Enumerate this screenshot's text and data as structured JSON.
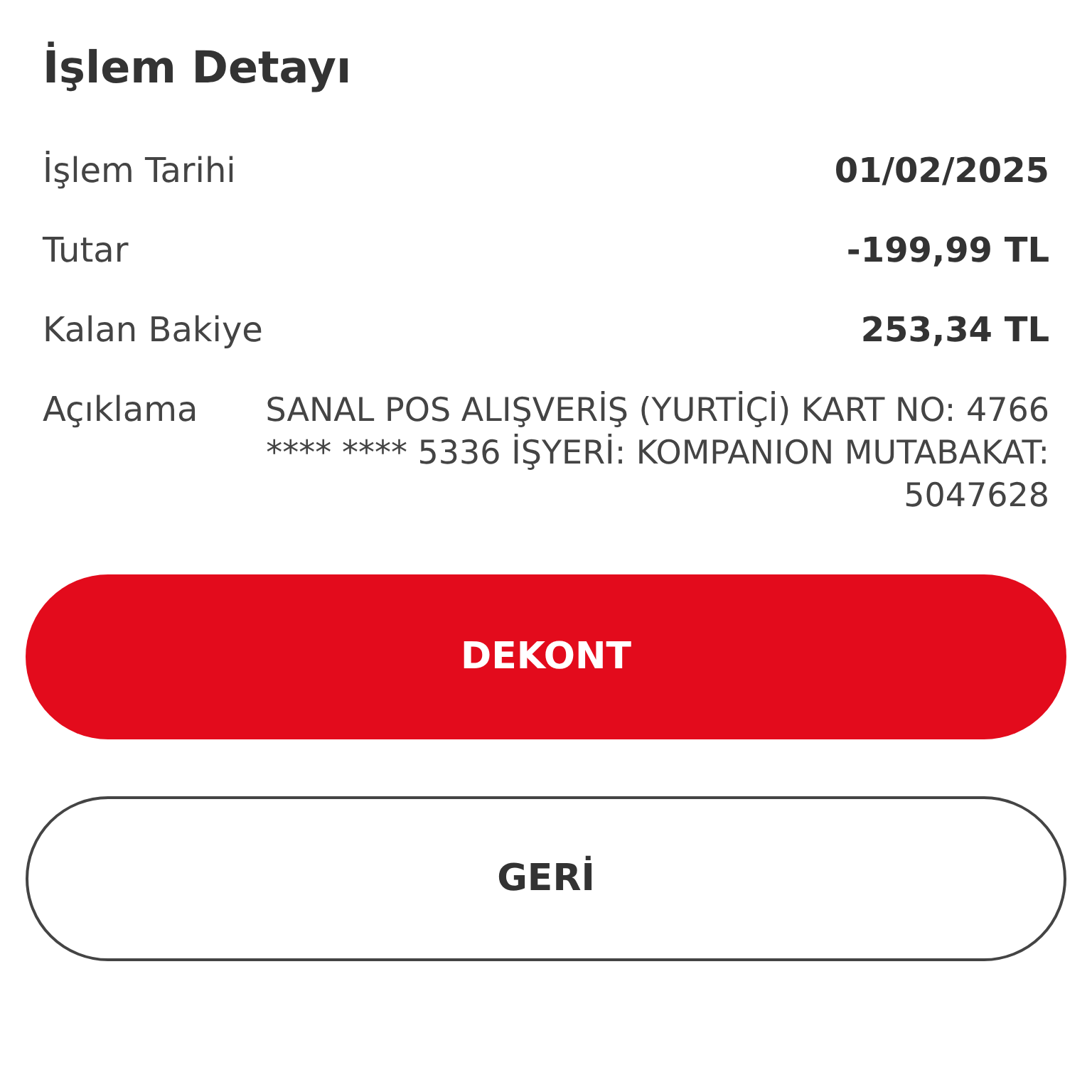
{
  "title": "İşlem Detayı",
  "rows": [
    {
      "label": "İşlem Tarihi",
      "value": "01/02/2025",
      "kind": "bold"
    },
    {
      "label": "Tutar",
      "value": "-199,99 TL",
      "kind": "bold"
    },
    {
      "label": "Kalan Bakiye",
      "value": "253,34 TL",
      "kind": "bold"
    },
    {
      "label": "Açıklama",
      "value": "SANAL POS ALIŞVERİŞ (YURTİÇİ) KART NO: 4766 **** **** 5336 İŞYERİ: KOMPANION MUTABAKAT: 5047628",
      "kind": "plain"
    }
  ],
  "buttons": [
    {
      "label": "DEKONT",
      "kind": "primary"
    },
    {
      "label": "GERİ",
      "kind": "secondary"
    }
  ]
}
